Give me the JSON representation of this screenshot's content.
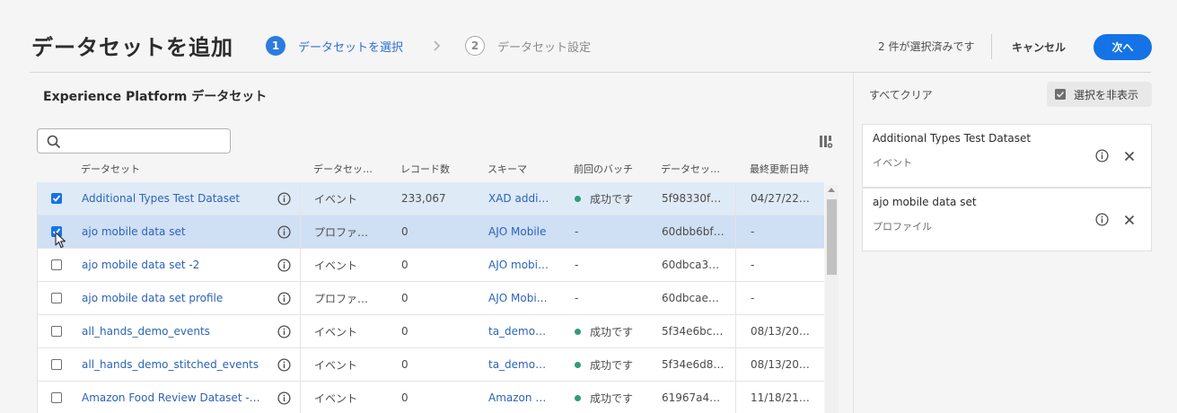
{
  "header": {
    "title": "データセットを追加",
    "step1": {
      "num": "1",
      "label": "データセットを選択"
    },
    "step2": {
      "num": "2",
      "label": "データセット設定"
    },
    "selected_count": "2 件が選択済みです",
    "cancel_label": "キャンセル",
    "next_label": "次へ"
  },
  "left": {
    "title": "Experience Platform データセット",
    "search_placeholder": ""
  },
  "table": {
    "columns": [
      "データセット",
      "データセッ…",
      "レコード数",
      "スキーマ",
      "前回のバッチ",
      "データセッ…",
      "最終更新日時"
    ],
    "rows": [
      {
        "checked": true,
        "name": "Additional Types Test Dataset",
        "type": "イベント",
        "records": "233,067",
        "schema": "XAD addi…",
        "batch": "成功です",
        "batch_ok": true,
        "id": "5f98330f…",
        "updated": "04/27/22…"
      },
      {
        "checked": true,
        "name": "ajo mobile data set",
        "type": "プロファ…",
        "records": "0",
        "schema": "AJO Mobile",
        "batch": "-",
        "batch_ok": false,
        "id": "60dbb6bf…",
        "updated": "-"
      },
      {
        "checked": false,
        "name": "ajo mobile data set -2",
        "type": "イベント",
        "records": "0",
        "schema": "AJO mobi…",
        "batch": "-",
        "batch_ok": false,
        "id": "60dbca3…",
        "updated": "-"
      },
      {
        "checked": false,
        "name": "ajo mobile data set profile",
        "type": "プロファ…",
        "records": "0",
        "schema": "AJO Mobi…",
        "batch": "-",
        "batch_ok": false,
        "id": "60dbcae…",
        "updated": "-"
      },
      {
        "checked": false,
        "name": "all_hands_demo_events",
        "type": "イベント",
        "records": "0",
        "schema": "ta_demo…",
        "batch": "成功です",
        "batch_ok": true,
        "id": "5f34e6bc…",
        "updated": "08/13/20…"
      },
      {
        "checked": false,
        "name": "all_hands_demo_stitched_events",
        "type": "イベント",
        "records": "0",
        "schema": "ta_demo…",
        "batch": "成功です",
        "batch_ok": true,
        "id": "5f34e6d8…",
        "updated": "08/13/20…"
      },
      {
        "checked": false,
        "name": "Amazon Food Review Dataset -…",
        "type": "イベント",
        "records": "0",
        "schema": "Amazon …",
        "batch": "成功です",
        "batch_ok": true,
        "id": "61967a4…",
        "updated": "11/18/21…"
      }
    ]
  },
  "right": {
    "clear_all": "すべてクリア",
    "hide_selected": "選択を非表示",
    "cards": [
      {
        "name": "Additional Types Test Dataset",
        "type": "イベント"
      },
      {
        "name": "ajo mobile data set",
        "type": "プロファイル"
      }
    ]
  },
  "colors": {
    "accent": "#1473e6",
    "link": "#2b63b8",
    "success": "#2d9d78",
    "selected_row": "#cfdff4"
  }
}
